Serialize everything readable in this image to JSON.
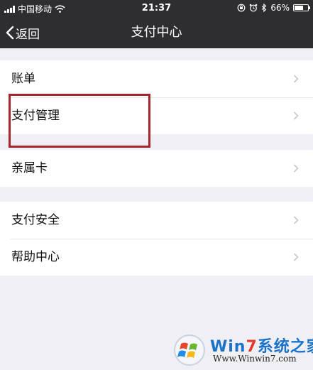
{
  "status_bar": {
    "carrier": "中国移动",
    "time": "21:37",
    "battery": "66%",
    "battery_level": 0.66
  },
  "nav": {
    "back_label": "返回",
    "title": "支付中心"
  },
  "menu": {
    "group1": [
      {
        "label": "账单"
      },
      {
        "label": "支付管理"
      }
    ],
    "group2": [
      {
        "label": "亲属卡"
      }
    ],
    "group3": [
      {
        "label": "支付安全"
      },
      {
        "label": "帮助中心"
      }
    ]
  },
  "watermark": {
    "brand_prefix": "Win",
    "brand_seven": "7",
    "brand_suffix": "系统之家",
    "url": "Www.Winwin7.com"
  },
  "colors": {
    "nav_bg": "#2e2e31",
    "page_bg": "#efeff4",
    "highlight": "#a6242b"
  },
  "icons": {
    "back": "chevron-left-icon",
    "row": "chevron-right-icon",
    "wifi": "wifi-icon",
    "alarm": "alarm-icon",
    "bluetooth": "bluetooth-icon",
    "rotation_lock": "rotation-lock-icon"
  }
}
